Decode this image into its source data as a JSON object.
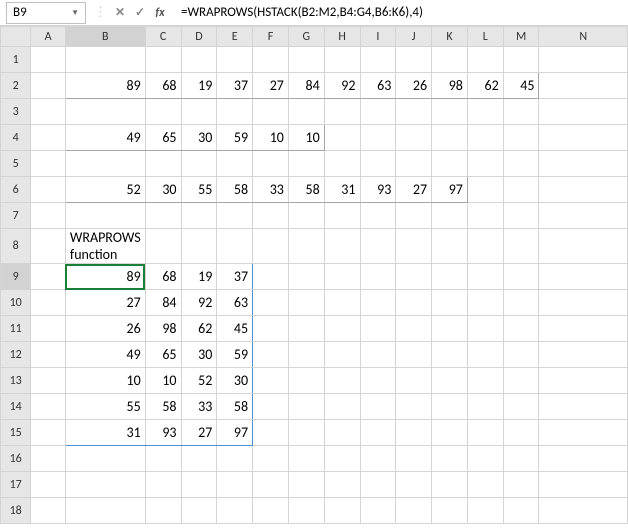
{
  "nameBox": "B9",
  "formula": "=WRAPROWS(HSTACK(B2:M2,B4:G4,B6:K6),4)",
  "columns": [
    "A",
    "B",
    "C",
    "D",
    "E",
    "F",
    "G",
    "H",
    "I",
    "J",
    "K",
    "L",
    "M",
    "N"
  ],
  "colWidths": {
    "default": 37,
    "N": 96
  },
  "rowCount": 18,
  "activeCell": {
    "row": 9,
    "col": "B"
  },
  "label": {
    "row": 8,
    "col": "B",
    "text": "WRAPROWS function"
  },
  "dataRanges": [
    {
      "row": 2,
      "cols": [
        "B",
        "C",
        "D",
        "E",
        "F",
        "G",
        "H",
        "I",
        "J",
        "K",
        "L",
        "M"
      ],
      "vals": [
        89,
        68,
        19,
        37,
        27,
        84,
        92,
        63,
        26,
        98,
        62,
        45
      ],
      "bordered": true
    },
    {
      "row": 4,
      "cols": [
        "B",
        "C",
        "D",
        "E",
        "F",
        "G"
      ],
      "vals": [
        49,
        65,
        30,
        59,
        10,
        10
      ],
      "bordered": true
    },
    {
      "row": 6,
      "cols": [
        "B",
        "C",
        "D",
        "E",
        "F",
        "G",
        "H",
        "I",
        "J",
        "K"
      ],
      "vals": [
        52,
        30,
        55,
        58,
        33,
        58,
        31,
        93,
        27,
        97
      ],
      "bordered": true
    }
  ],
  "spillRange": {
    "r1": 9,
    "r2": 15,
    "c1": "B",
    "c2": "E"
  },
  "spill": [
    {
      "row": 9,
      "cols": [
        "B",
        "C",
        "D",
        "E"
      ],
      "vals": [
        89,
        68,
        19,
        37
      ]
    },
    {
      "row": 10,
      "cols": [
        "B",
        "C",
        "D",
        "E"
      ],
      "vals": [
        27,
        84,
        92,
        63
      ]
    },
    {
      "row": 11,
      "cols": [
        "B",
        "C",
        "D",
        "E"
      ],
      "vals": [
        26,
        98,
        62,
        45
      ]
    },
    {
      "row": 12,
      "cols": [
        "B",
        "C",
        "D",
        "E"
      ],
      "vals": [
        49,
        65,
        30,
        59
      ]
    },
    {
      "row": 13,
      "cols": [
        "B",
        "C",
        "D",
        "E"
      ],
      "vals": [
        10,
        10,
        52,
        30
      ]
    },
    {
      "row": 14,
      "cols": [
        "B",
        "C",
        "D",
        "E"
      ],
      "vals": [
        55,
        58,
        33,
        58
      ]
    },
    {
      "row": 15,
      "cols": [
        "B",
        "C",
        "D",
        "E"
      ],
      "vals": [
        31,
        93,
        27,
        97
      ]
    }
  ],
  "chart_data": {
    "type": "table",
    "title": "WRAPROWS function",
    "inputs": {
      "range1": [
        89,
        68,
        19,
        37,
        27,
        84,
        92,
        63,
        26,
        98,
        62,
        45
      ],
      "range2": [
        49,
        65,
        30,
        59,
        10,
        10
      ],
      "range3": [
        52,
        30,
        55,
        58,
        33,
        58,
        31,
        93,
        27,
        97
      ]
    },
    "output": [
      [
        89,
        68,
        19,
        37
      ],
      [
        27,
        84,
        92,
        63
      ],
      [
        26,
        98,
        62,
        45
      ],
      [
        49,
        65,
        30,
        59
      ],
      [
        10,
        10,
        52,
        30
      ],
      [
        55,
        58,
        33,
        58
      ],
      [
        31,
        93,
        27,
        97
      ]
    ]
  }
}
